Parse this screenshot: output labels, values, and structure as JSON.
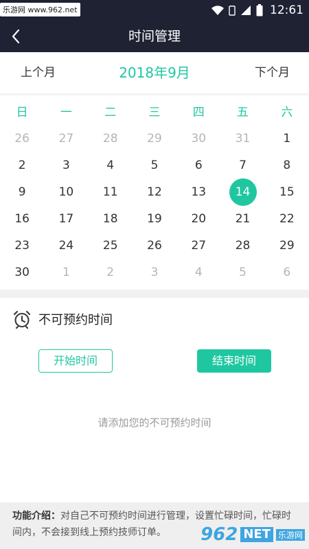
{
  "statusbar": {
    "watermark": "乐游网 www.962.net",
    "time": "12:61"
  },
  "header": {
    "title": "时间管理"
  },
  "month_nav": {
    "prev": "上个月",
    "current": "2018年9月",
    "next": "下个月"
  },
  "calendar": {
    "weekdays": [
      "日",
      "一",
      "二",
      "三",
      "四",
      "五",
      "六"
    ],
    "weeks": [
      [
        {
          "d": "26",
          "m": true
        },
        {
          "d": "27",
          "m": true
        },
        {
          "d": "28",
          "m": true
        },
        {
          "d": "29",
          "m": true
        },
        {
          "d": "30",
          "m": true
        },
        {
          "d": "31",
          "m": true
        },
        {
          "d": "1",
          "m": false
        }
      ],
      [
        {
          "d": "2",
          "m": false
        },
        {
          "d": "3",
          "m": false
        },
        {
          "d": "4",
          "m": false
        },
        {
          "d": "5",
          "m": false
        },
        {
          "d": "6",
          "m": false
        },
        {
          "d": "7",
          "m": false
        },
        {
          "d": "8",
          "m": false
        }
      ],
      [
        {
          "d": "9",
          "m": false
        },
        {
          "d": "10",
          "m": false
        },
        {
          "d": "11",
          "m": false
        },
        {
          "d": "12",
          "m": false
        },
        {
          "d": "13",
          "m": false
        },
        {
          "d": "14",
          "m": false,
          "selected": true
        },
        {
          "d": "15",
          "m": false
        }
      ],
      [
        {
          "d": "16",
          "m": false
        },
        {
          "d": "17",
          "m": false
        },
        {
          "d": "18",
          "m": false
        },
        {
          "d": "19",
          "m": false
        },
        {
          "d": "20",
          "m": false
        },
        {
          "d": "21",
          "m": false
        },
        {
          "d": "22",
          "m": false
        }
      ],
      [
        {
          "d": "23",
          "m": false
        },
        {
          "d": "24",
          "m": false
        },
        {
          "d": "25",
          "m": false
        },
        {
          "d": "26",
          "m": false
        },
        {
          "d": "27",
          "m": false
        },
        {
          "d": "28",
          "m": false
        },
        {
          "d": "29",
          "m": false
        }
      ],
      [
        {
          "d": "30",
          "m": false
        },
        {
          "d": "1",
          "m": true
        },
        {
          "d": "2",
          "m": true
        },
        {
          "d": "3",
          "m": true
        },
        {
          "d": "4",
          "m": true
        },
        {
          "d": "5",
          "m": true
        },
        {
          "d": "6",
          "m": true
        }
      ]
    ]
  },
  "unavailable": {
    "title": "不可预约时间",
    "start_label": "开始时间",
    "end_label": "结束时间",
    "empty_text": "请添加您的不可预约时间"
  },
  "info": {
    "label": "功能介绍：",
    "text": "对自己不可预约时间进行管理，设置忙碌时间，忙碌时间内，不会接到线上预约技师订单。"
  },
  "watermark_logo": {
    "num": "962",
    "net": "NET",
    "cn": "乐游网"
  },
  "colors": {
    "accent": "#1fc7a0",
    "header_bg": "#1f2233",
    "muted": "#b5b5b5"
  },
  "icons": {
    "back": "chevron-left-icon",
    "alarm": "alarm-clock-icon"
  }
}
